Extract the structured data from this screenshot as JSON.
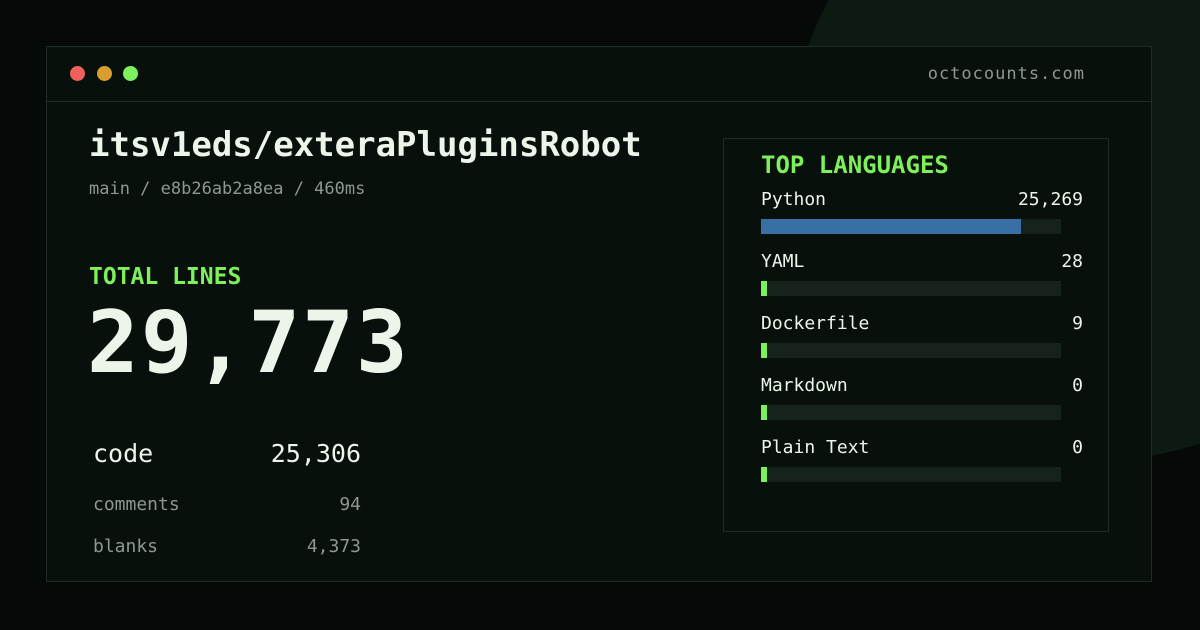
{
  "window": {
    "site": "octocounts.com",
    "dots": [
      "#f0605a",
      "#d99e2b",
      "#7ef05c"
    ]
  },
  "repo": {
    "title": "itsv1eds/exteraPluginsRobot",
    "meta": "main / e8b26ab2a8ea / 460ms"
  },
  "totals": {
    "label": "TOTAL LINES",
    "value": "29,773",
    "code_label": "code",
    "code_value": "25,306",
    "comments_label": "comments",
    "comments_value": "94",
    "blanks_label": "blanks",
    "blanks_value": "4,373"
  },
  "languages": {
    "heading": "TOP LANGUAGES",
    "items": [
      {
        "name": "Python",
        "count": "25,269",
        "fraction": 0.867,
        "color": "#3a6fa5"
      },
      {
        "name": "YAML",
        "count": "28",
        "fraction": 0.02,
        "color": "#7ef05c"
      },
      {
        "name": "Dockerfile",
        "count": "9",
        "fraction": 0.02,
        "color": "#7ef05c"
      },
      {
        "name": "Markdown",
        "count": "0",
        "fraction": 0.02,
        "color": "#7ef05c"
      },
      {
        "name": "Plain Text",
        "count": "0",
        "fraction": 0.02,
        "color": "#7ef05c"
      }
    ]
  },
  "colors": {
    "accent": "#7ef05c",
    "text": "#edf5ea",
    "muted": "#8a9a90"
  }
}
